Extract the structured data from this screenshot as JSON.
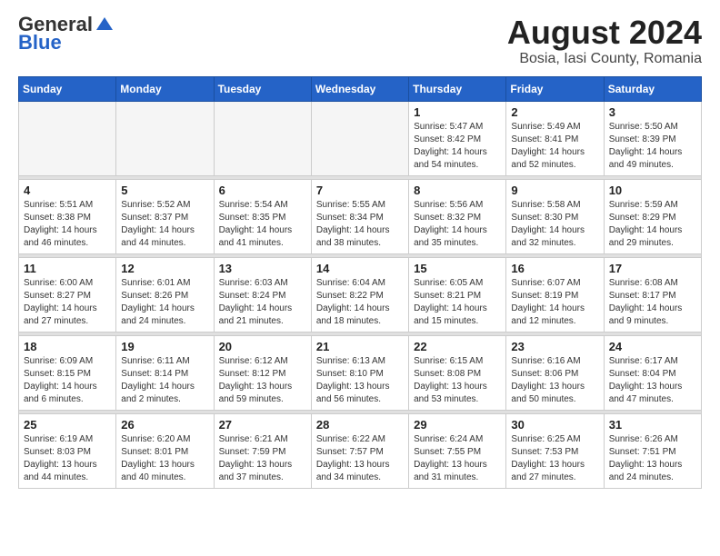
{
  "header": {
    "logo_general": "General",
    "logo_blue": "Blue",
    "title": "August 2024",
    "subtitle": "Bosia, Iasi County, Romania"
  },
  "weekdays": [
    "Sunday",
    "Monday",
    "Tuesday",
    "Wednesday",
    "Thursday",
    "Friday",
    "Saturday"
  ],
  "weeks": [
    {
      "days": [
        {
          "number": "",
          "empty": true
        },
        {
          "number": "",
          "empty": true
        },
        {
          "number": "",
          "empty": true
        },
        {
          "number": "",
          "empty": true
        },
        {
          "number": "1",
          "sunrise": "5:47 AM",
          "sunset": "8:42 PM",
          "daylight": "14 hours and 54 minutes."
        },
        {
          "number": "2",
          "sunrise": "5:49 AM",
          "sunset": "8:41 PM",
          "daylight": "14 hours and 52 minutes."
        },
        {
          "number": "3",
          "sunrise": "5:50 AM",
          "sunset": "8:39 PM",
          "daylight": "14 hours and 49 minutes."
        }
      ]
    },
    {
      "days": [
        {
          "number": "4",
          "sunrise": "5:51 AM",
          "sunset": "8:38 PM",
          "daylight": "14 hours and 46 minutes."
        },
        {
          "number": "5",
          "sunrise": "5:52 AM",
          "sunset": "8:37 PM",
          "daylight": "14 hours and 44 minutes."
        },
        {
          "number": "6",
          "sunrise": "5:54 AM",
          "sunset": "8:35 PM",
          "daylight": "14 hours and 41 minutes."
        },
        {
          "number": "7",
          "sunrise": "5:55 AM",
          "sunset": "8:34 PM",
          "daylight": "14 hours and 38 minutes."
        },
        {
          "number": "8",
          "sunrise": "5:56 AM",
          "sunset": "8:32 PM",
          "daylight": "14 hours and 35 minutes."
        },
        {
          "number": "9",
          "sunrise": "5:58 AM",
          "sunset": "8:30 PM",
          "daylight": "14 hours and 32 minutes."
        },
        {
          "number": "10",
          "sunrise": "5:59 AM",
          "sunset": "8:29 PM",
          "daylight": "14 hours and 29 minutes."
        }
      ]
    },
    {
      "days": [
        {
          "number": "11",
          "sunrise": "6:00 AM",
          "sunset": "8:27 PM",
          "daylight": "14 hours and 27 minutes."
        },
        {
          "number": "12",
          "sunrise": "6:01 AM",
          "sunset": "8:26 PM",
          "daylight": "14 hours and 24 minutes."
        },
        {
          "number": "13",
          "sunrise": "6:03 AM",
          "sunset": "8:24 PM",
          "daylight": "14 hours and 21 minutes."
        },
        {
          "number": "14",
          "sunrise": "6:04 AM",
          "sunset": "8:22 PM",
          "daylight": "14 hours and 18 minutes."
        },
        {
          "number": "15",
          "sunrise": "6:05 AM",
          "sunset": "8:21 PM",
          "daylight": "14 hours and 15 minutes."
        },
        {
          "number": "16",
          "sunrise": "6:07 AM",
          "sunset": "8:19 PM",
          "daylight": "14 hours and 12 minutes."
        },
        {
          "number": "17",
          "sunrise": "6:08 AM",
          "sunset": "8:17 PM",
          "daylight": "14 hours and 9 minutes."
        }
      ]
    },
    {
      "days": [
        {
          "number": "18",
          "sunrise": "6:09 AM",
          "sunset": "8:15 PM",
          "daylight": "14 hours and 6 minutes."
        },
        {
          "number": "19",
          "sunrise": "6:11 AM",
          "sunset": "8:14 PM",
          "daylight": "14 hours and 2 minutes."
        },
        {
          "number": "20",
          "sunrise": "6:12 AM",
          "sunset": "8:12 PM",
          "daylight": "13 hours and 59 minutes."
        },
        {
          "number": "21",
          "sunrise": "6:13 AM",
          "sunset": "8:10 PM",
          "daylight": "13 hours and 56 minutes."
        },
        {
          "number": "22",
          "sunrise": "6:15 AM",
          "sunset": "8:08 PM",
          "daylight": "13 hours and 53 minutes."
        },
        {
          "number": "23",
          "sunrise": "6:16 AM",
          "sunset": "8:06 PM",
          "daylight": "13 hours and 50 minutes."
        },
        {
          "number": "24",
          "sunrise": "6:17 AM",
          "sunset": "8:04 PM",
          "daylight": "13 hours and 47 minutes."
        }
      ]
    },
    {
      "days": [
        {
          "number": "25",
          "sunrise": "6:19 AM",
          "sunset": "8:03 PM",
          "daylight": "13 hours and 44 minutes."
        },
        {
          "number": "26",
          "sunrise": "6:20 AM",
          "sunset": "8:01 PM",
          "daylight": "13 hours and 40 minutes."
        },
        {
          "number": "27",
          "sunrise": "6:21 AM",
          "sunset": "7:59 PM",
          "daylight": "13 hours and 37 minutes."
        },
        {
          "number": "28",
          "sunrise": "6:22 AM",
          "sunset": "7:57 PM",
          "daylight": "13 hours and 34 minutes."
        },
        {
          "number": "29",
          "sunrise": "6:24 AM",
          "sunset": "7:55 PM",
          "daylight": "13 hours and 31 minutes."
        },
        {
          "number": "30",
          "sunrise": "6:25 AM",
          "sunset": "7:53 PM",
          "daylight": "13 hours and 27 minutes."
        },
        {
          "number": "31",
          "sunrise": "6:26 AM",
          "sunset": "7:51 PM",
          "daylight": "13 hours and 24 minutes."
        }
      ]
    }
  ]
}
